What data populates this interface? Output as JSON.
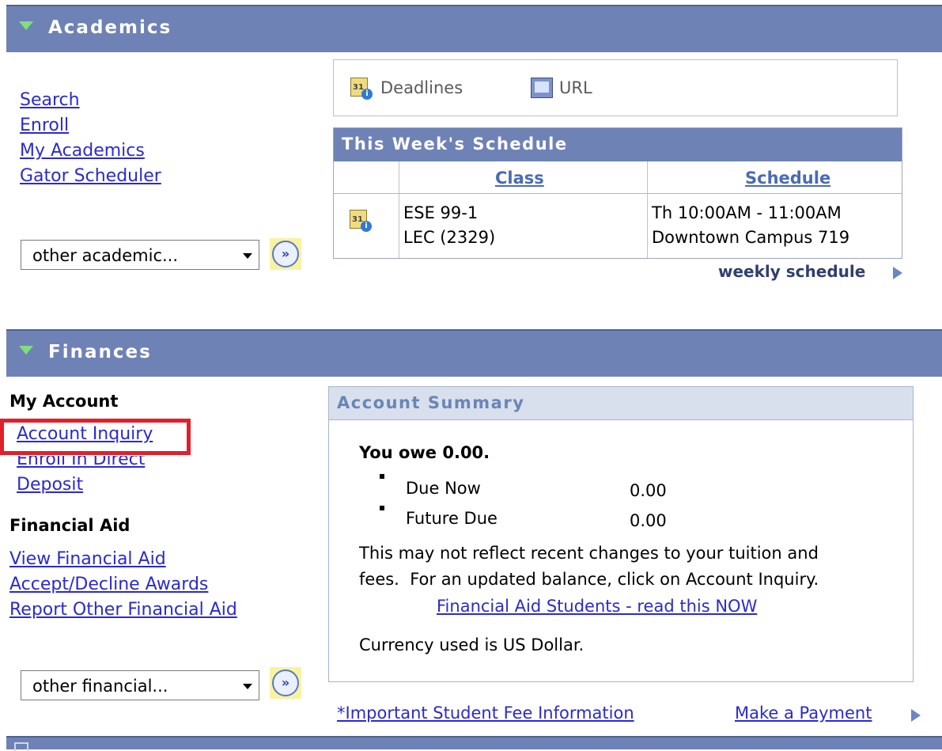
{
  "academics": {
    "title": "Academics",
    "links": [
      "Search",
      "Enroll",
      "My Academics",
      "Gator Scheduler"
    ],
    "dropdown_value": "other academic...",
    "toolbar": {
      "deadlines": "Deadlines",
      "url": "URL"
    },
    "schedule": {
      "title": "This Week's Schedule",
      "headers": {
        "class": "Class",
        "schedule": "Schedule"
      },
      "row": {
        "class_line1": "ESE 99-1",
        "class_line2": "LEC (2329)",
        "sched_line1": "Th 10:00AM - 11:00AM",
        "sched_line2": "Downtown Campus 719"
      },
      "weekly_link": "weekly schedule"
    }
  },
  "finances": {
    "title": "Finances",
    "my_account_heading": "My Account",
    "my_account_links": [
      "Account Inquiry",
      "Enroll In Direct",
      "Deposit"
    ],
    "financial_aid_heading": "Financial Aid",
    "financial_aid_links": [
      "View Financial Aid",
      "Accept/Decline Awards",
      "Report Other Financial Aid"
    ],
    "dropdown_value": "other financial...",
    "summary": {
      "title": "Account Summary",
      "you_owe": "You owe 0.00.",
      "items": [
        {
          "label": "Due Now",
          "value": "0.00"
        },
        {
          "label": "Future Due",
          "value": "0.00"
        }
      ],
      "note_line1": "This may not reflect recent changes to your tuition and",
      "note_line2": "fees.  For an updated balance, click on Account Inquiry.",
      "fa_link": "Financial Aid Students - read this NOW",
      "currency": "Currency used is US Dollar."
    },
    "fee_link": "*Important Student Fee Information",
    "payment_link": "Make a Payment"
  },
  "colors": {
    "section_bar": "#6f82b5",
    "highlight_box": "#e0202a",
    "link": "#2a2ad0"
  }
}
